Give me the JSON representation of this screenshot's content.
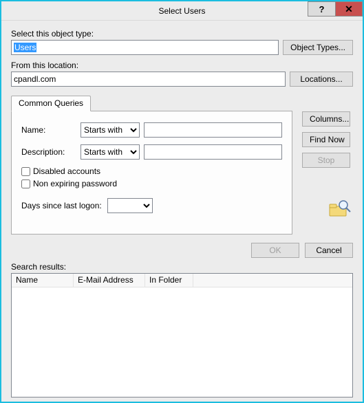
{
  "window": {
    "title": "Select Users",
    "help_glyph": "?",
    "close_glyph": "✕"
  },
  "object_type": {
    "label": "Select this object type:",
    "value": "Users",
    "button": "Object Types..."
  },
  "location": {
    "label": "From this location:",
    "value": "cpandl.com",
    "button": "Locations..."
  },
  "queries": {
    "tab_label": "Common Queries",
    "name_label": "Name:",
    "name_match": "Starts with",
    "name_value": "",
    "desc_label": "Description:",
    "desc_match": "Starts with",
    "desc_value": "",
    "disabled_label": "Disabled accounts",
    "nonexpire_label": "Non expiring password",
    "days_label": "Days since last logon:",
    "days_value": ""
  },
  "side": {
    "columns": "Columns...",
    "find_now": "Find Now",
    "stop": "Stop"
  },
  "actions": {
    "ok": "OK",
    "cancel": "Cancel"
  },
  "results": {
    "label": "Search results:",
    "columns": {
      "name": "Name",
      "email": "E-Mail Address",
      "folder": "In Folder"
    }
  }
}
